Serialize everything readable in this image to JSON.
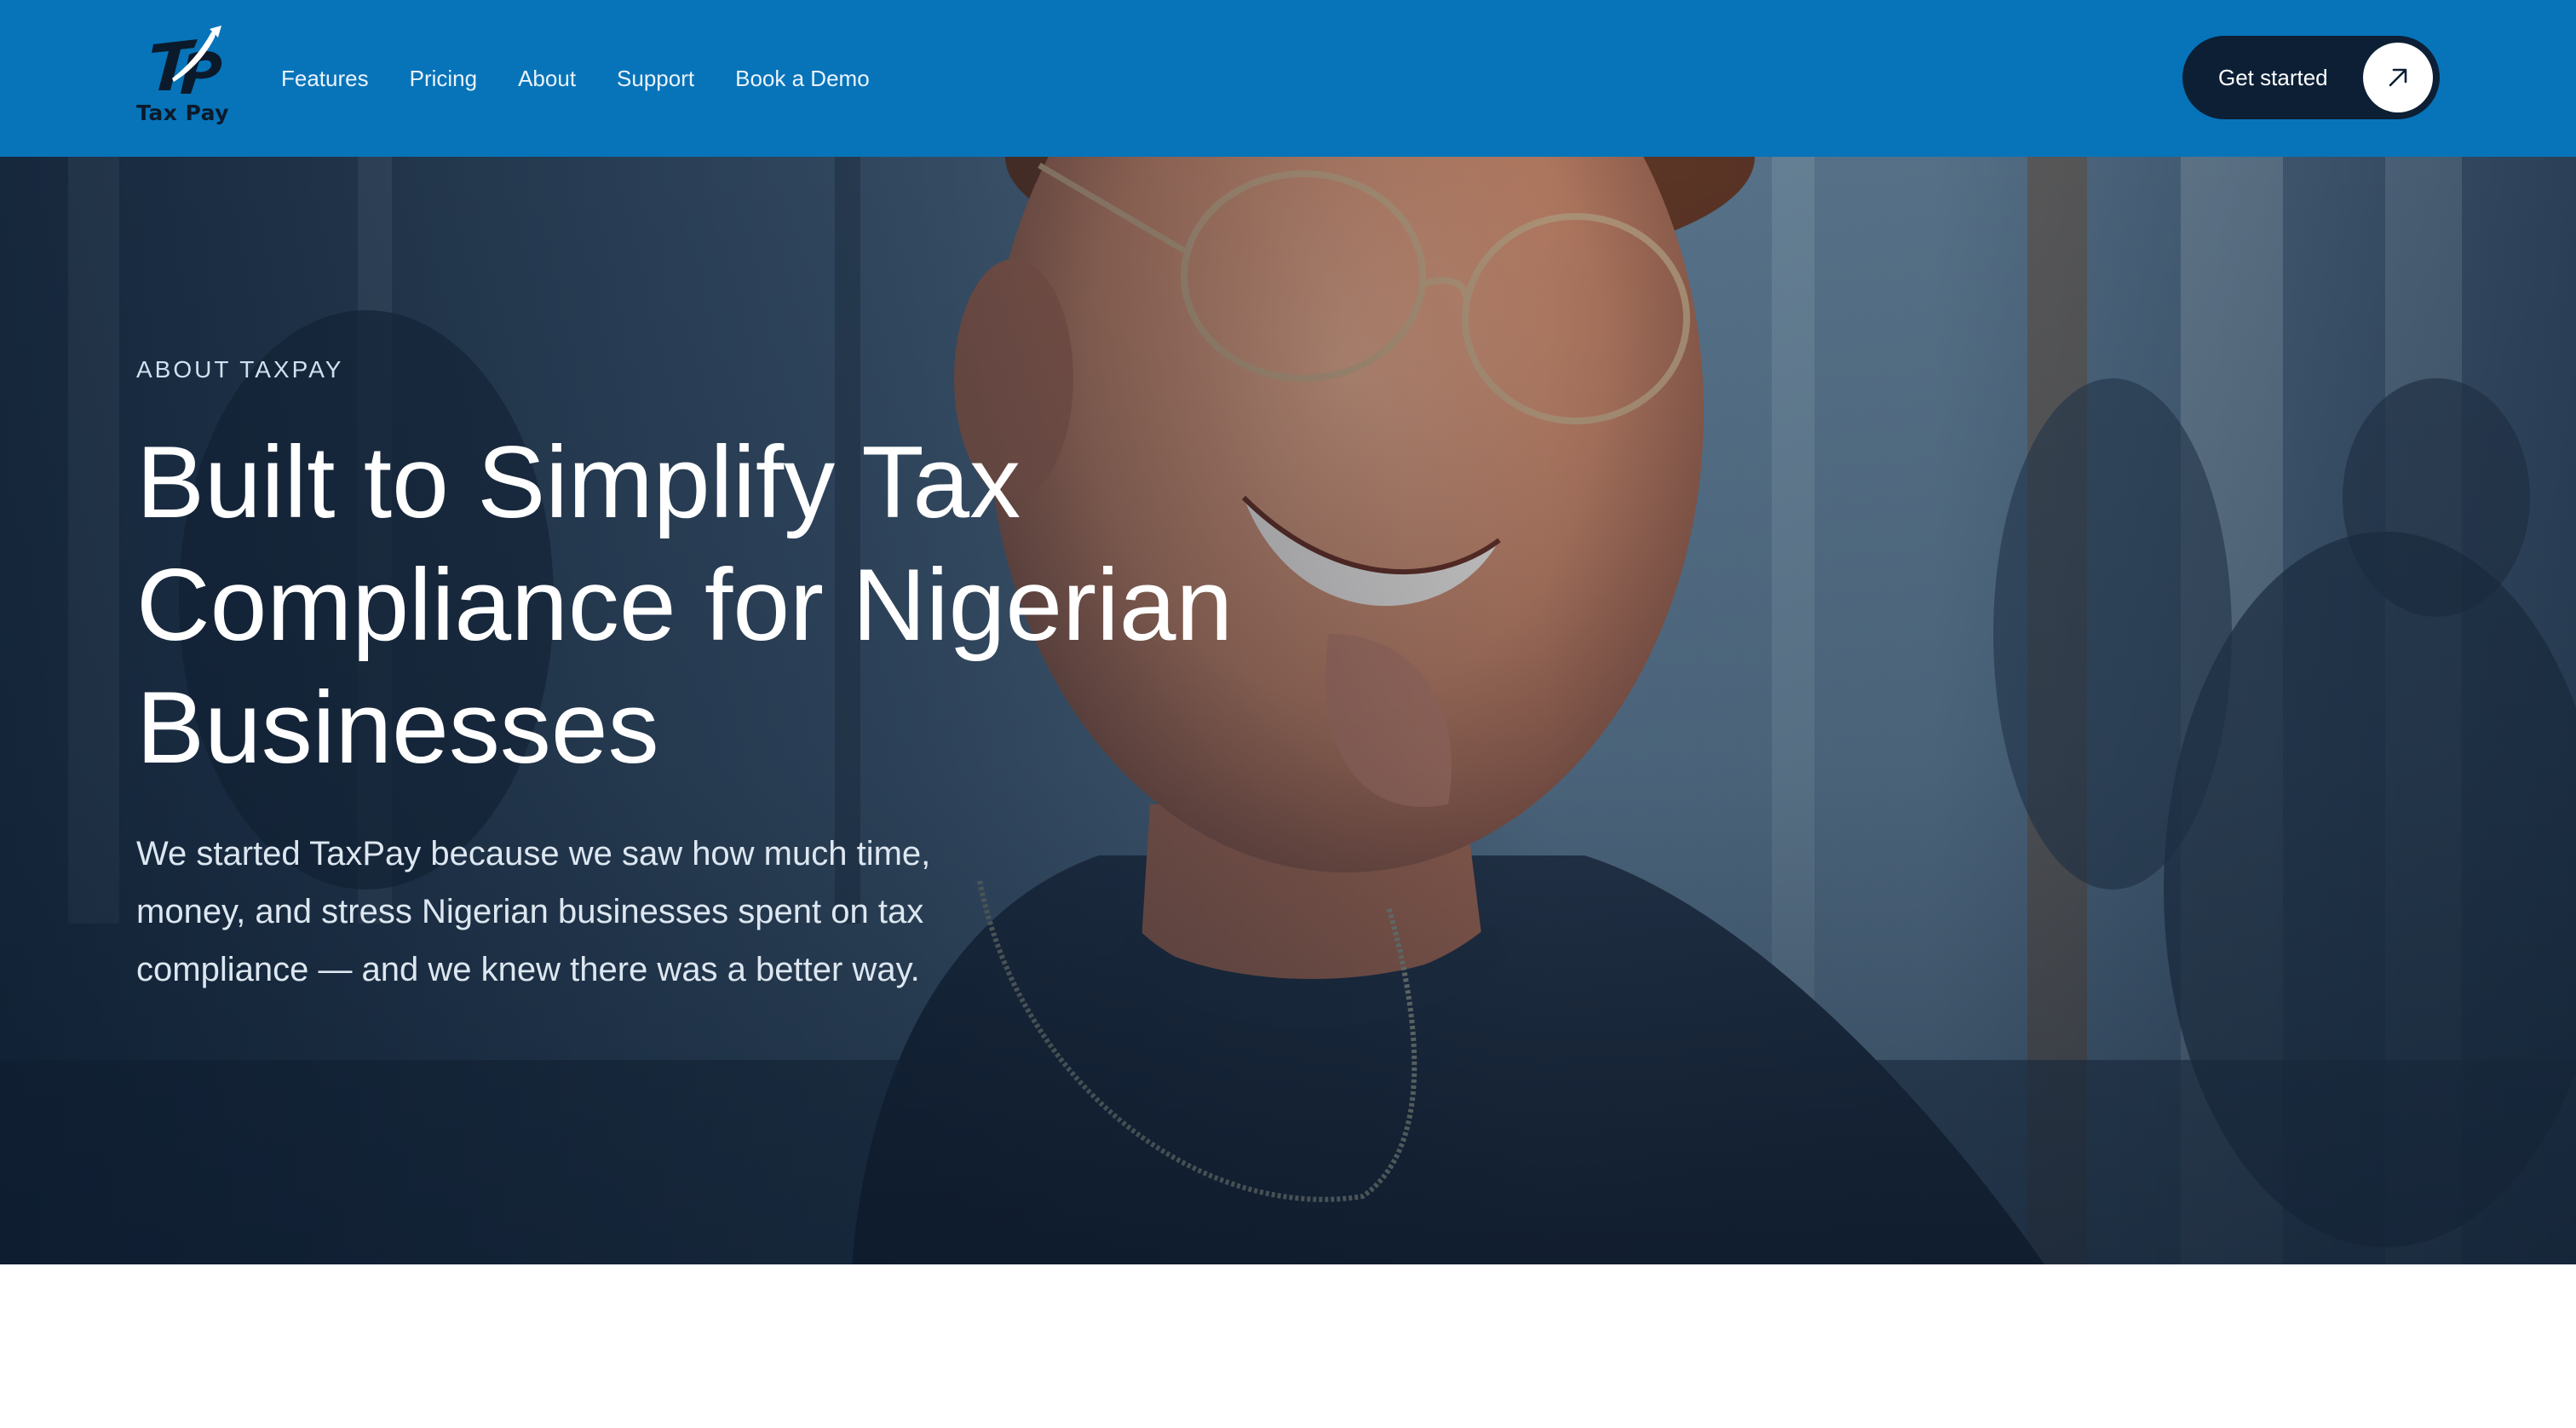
{
  "brand": {
    "name": "Tax Pay",
    "primary_color": "#0774b9",
    "dark_color": "#0c1f35"
  },
  "nav": {
    "links": [
      "Features",
      "Pricing",
      "About",
      "Support",
      "Book a Demo"
    ],
    "cta_label": "Get started",
    "cta_icon": "arrow-up-right-icon"
  },
  "hero": {
    "eyebrow": "ABOUT TAXPAY",
    "title": "Built to Simplify Tax Compliance for Nigerian Businesses",
    "subtitle": "We started TaxPay because we saw how much time, money, and stress Nigerian businesses spent on tax compliance — and we knew there was a better way.",
    "background_image": "smiling-man-with-glasses-in-office"
  }
}
